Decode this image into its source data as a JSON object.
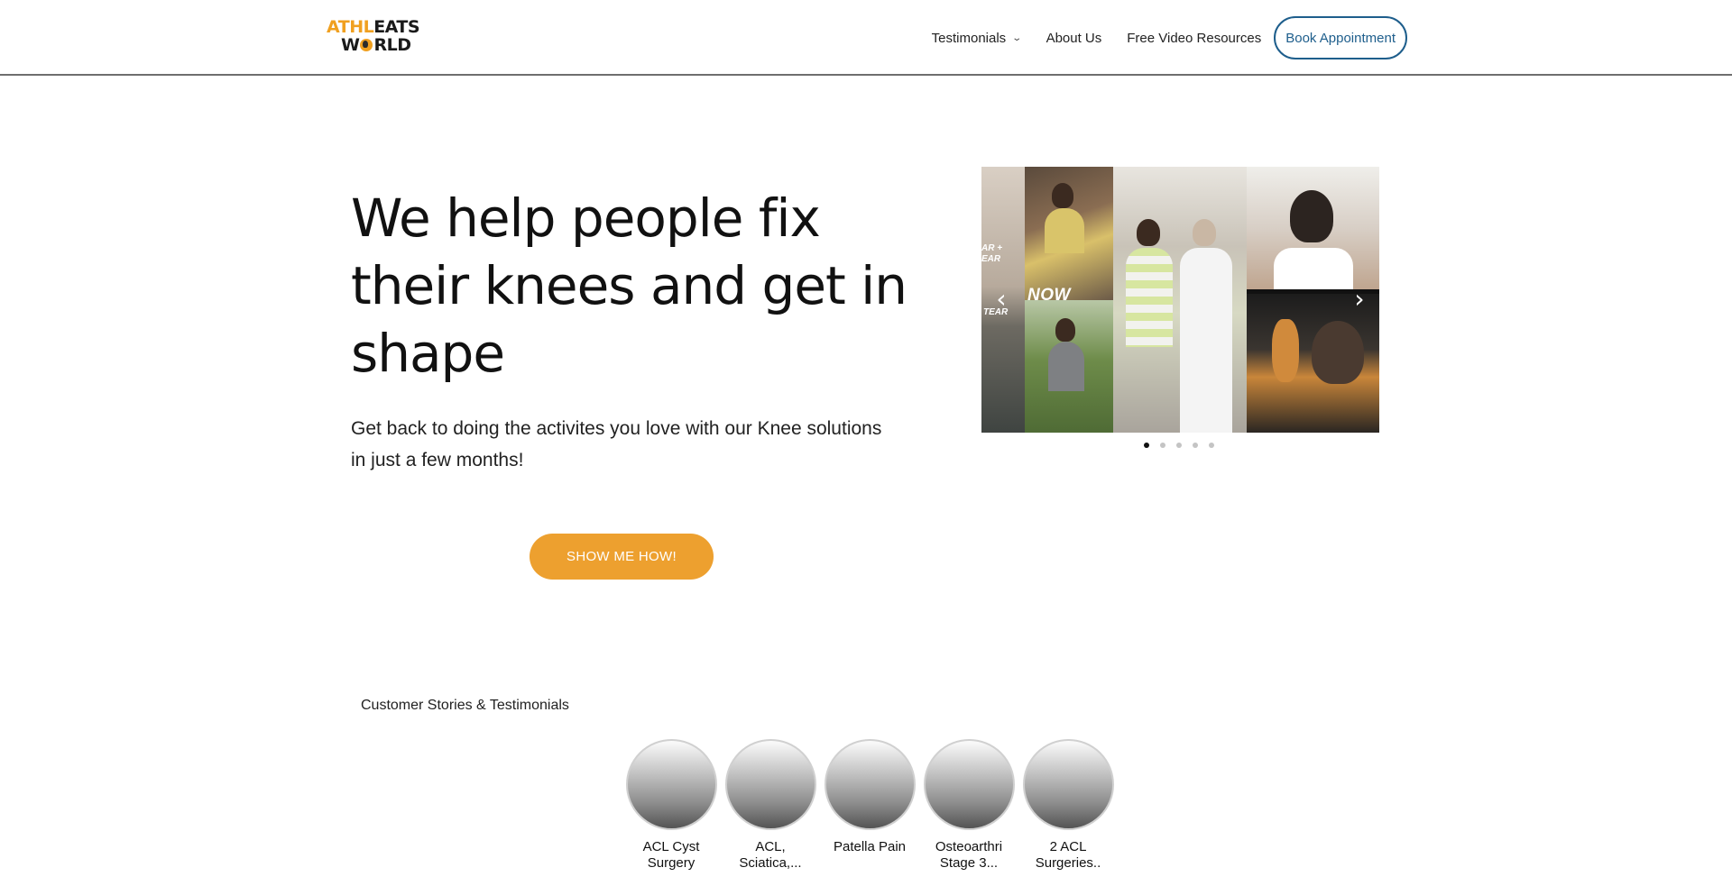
{
  "header": {
    "logo": {
      "line1_orange": "ATHL",
      "line1_dark": "EATS",
      "line2_before": "W",
      "line2_after": "RLD"
    },
    "nav": [
      {
        "label": "Testimonials",
        "has_dropdown": true
      },
      {
        "label": "About Us"
      },
      {
        "label": "Free Video Resources"
      }
    ],
    "book_button": "Book Appointment"
  },
  "hero": {
    "title": "We help people fix their knees and get in shape",
    "subtitle": "Get back to doing the activites you love with our Knee solutions in just a few months!",
    "cta": "SHOW ME HOW!"
  },
  "slider": {
    "overlay_now": "NOW",
    "overlay_tear_top": "AR +\nEAR",
    "overlay_tear_bottom": "TEAR",
    "prev_icon": "chevron-left-icon",
    "next_icon": "chevron-right-icon",
    "slide_count": 5,
    "active_slide": 1
  },
  "testimonials": {
    "heading": "Customer Stories & Testimonials",
    "stories": [
      {
        "label": "ACL Cyst Surgery"
      },
      {
        "label": "ACL, Sciatica,..."
      },
      {
        "label": "Patella Pain"
      },
      {
        "label": "Osteoarthri Stage 3..."
      },
      {
        "label": "2 ACL Surgeries.."
      }
    ]
  },
  "colors": {
    "accent": "#eda02f",
    "book_button": "#1e5e8c"
  }
}
